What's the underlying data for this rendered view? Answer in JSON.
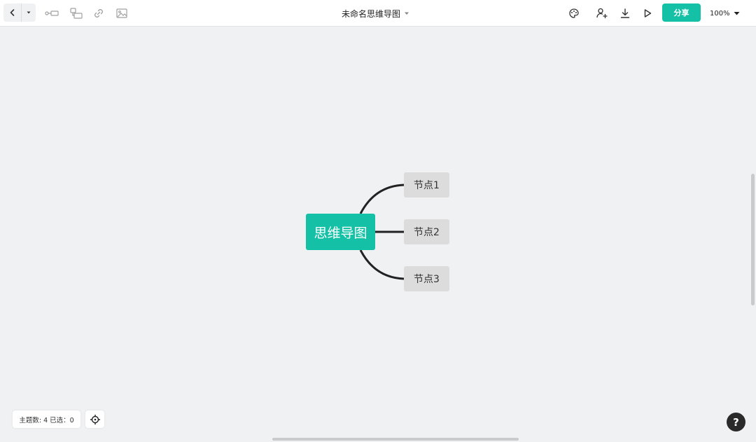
{
  "toolbar": {
    "title": "未命名思维导图",
    "share_label": "分享",
    "zoom_label": "100%",
    "left_icons": [
      "back-icon",
      "dropdown-arrow-icon",
      "subtopic-icon",
      "relation-icon",
      "link-icon",
      "image-icon"
    ],
    "right_icons": [
      "palette-icon",
      "add-user-icon",
      "download-icon",
      "play-icon"
    ]
  },
  "mindmap": {
    "root": "思维导图",
    "children": [
      "节点1",
      "节点2",
      "节点3"
    ]
  },
  "status": {
    "topics_label": "主题数: 4",
    "selected_label": "已选：0"
  },
  "help": {
    "label": "?"
  },
  "colors": {
    "accent": "#15c1a6",
    "node_bg": "#dcdcdc",
    "canvas_bg": "#f0f1f3",
    "connector": "#222222"
  }
}
